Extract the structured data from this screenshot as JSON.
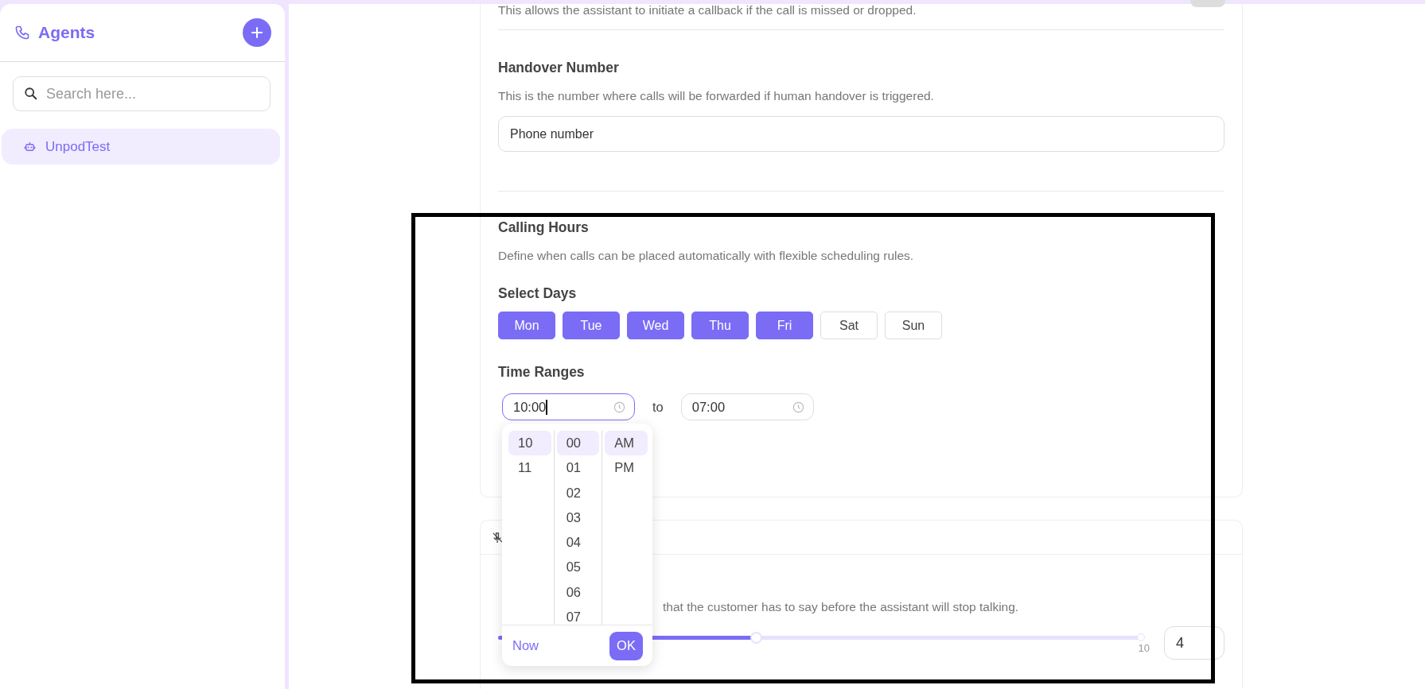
{
  "sidebar": {
    "title": "Agents",
    "search": {
      "placeholder": "Search here..."
    },
    "items": [
      {
        "label": "UnpodTest",
        "selected": true
      }
    ]
  },
  "callback": {
    "toggle": {
      "on": false
    },
    "description": "This allows the assistant to initiate a callback if the call is missed or dropped."
  },
  "handover": {
    "title": "Handover Number",
    "description": "This is the number where calls will be forwarded if human handover is triggered.",
    "field": {
      "placeholder": "Phone number"
    }
  },
  "calling_hours": {
    "title": "Calling Hours",
    "description": "Define when calls can be placed automatically with flexible scheduling rules.",
    "days_label": "Select Days",
    "days": [
      {
        "label": "Mon",
        "selected": true
      },
      {
        "label": "Tue",
        "selected": true
      },
      {
        "label": "Wed",
        "selected": true
      },
      {
        "label": "Thu",
        "selected": true
      },
      {
        "label": "Fri",
        "selected": true
      },
      {
        "label": "Sat",
        "selected": false
      },
      {
        "label": "Sun",
        "selected": false
      }
    ],
    "time_label": "Time Ranges",
    "from": {
      "value": "10:00",
      "focused": true
    },
    "separator": "to",
    "to": {
      "value": "07:00",
      "focused": false
    },
    "picker": {
      "hours": [
        {
          "label": "10",
          "selected": true
        },
        {
          "label": "11",
          "selected": false
        }
      ],
      "minutes": [
        {
          "label": "00",
          "selected": true
        },
        {
          "label": "01",
          "selected": false
        },
        {
          "label": "02",
          "selected": false
        },
        {
          "label": "03",
          "selected": false
        },
        {
          "label": "04",
          "selected": false
        },
        {
          "label": "05",
          "selected": false
        },
        {
          "label": "06",
          "selected": false
        },
        {
          "label": "07",
          "selected": false
        }
      ],
      "periods": [
        {
          "label": "AM",
          "selected": true
        },
        {
          "label": "PM",
          "selected": false
        }
      ],
      "now": "Now",
      "ok": "OK"
    }
  },
  "interruption": {
    "description_end": "that the customer has to say before the assistant will stop talking.",
    "slider": {
      "level": 0.4,
      "max_label": "10"
    },
    "value": "4"
  }
}
